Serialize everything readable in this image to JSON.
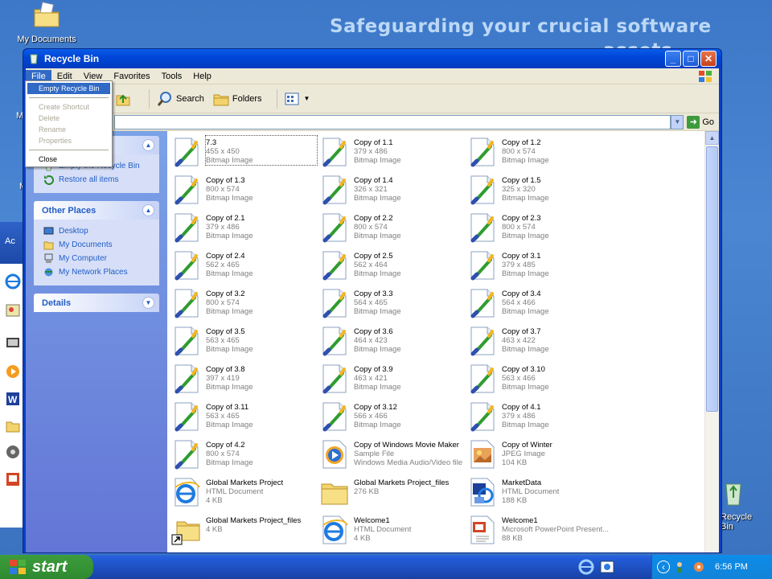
{
  "banner": {
    "line1": "Safeguarding your crucial software",
    "line2": "assets"
  },
  "desktop": {
    "my_documents": "My Documents",
    "recycle_bin": "Recycle Bin",
    "partial_labels": [
      "M",
      "M",
      "Ac"
    ]
  },
  "window": {
    "title": "Recycle Bin",
    "buttons": {
      "minimize": "_",
      "maximize": "□",
      "close": "✕"
    }
  },
  "menubar": [
    "File",
    "Edit",
    "View",
    "Favorites",
    "Tools",
    "Help"
  ],
  "file_menu": {
    "items": [
      {
        "label": "Empty Recycle Bin",
        "state": "highlighted"
      },
      {
        "label": "Create Shortcut",
        "state": "disabled"
      },
      {
        "label": "Delete",
        "state": "disabled"
      },
      {
        "label": "Rename",
        "state": "disabled"
      },
      {
        "label": "Properties",
        "state": "disabled"
      },
      {
        "label": "Close",
        "state": "normal"
      }
    ]
  },
  "toolbar": {
    "search": "Search",
    "folders": "Folders"
  },
  "address": {
    "go": "Go"
  },
  "tasks_panel": {
    "partial_items": [
      "Empty the Recycle Bin",
      "Restore all items"
    ]
  },
  "other_places": {
    "title": "Other Places",
    "items": [
      "Desktop",
      "My Documents",
      "My Computer",
      "My Network Places"
    ]
  },
  "details": {
    "title": "Details"
  },
  "files": [
    {
      "name": "7.3",
      "l2": "455 x 450",
      "l3": "Bitmap Image",
      "icon": "bitmap",
      "selected": true
    },
    {
      "name": "Copy of 1.1",
      "l2": "379 x 486",
      "l3": "Bitmap Image",
      "icon": "bitmap"
    },
    {
      "name": "Copy of 1.2",
      "l2": "800 x 574",
      "l3": "Bitmap Image",
      "icon": "bitmap"
    },
    {
      "name": "Copy of 1.3",
      "l2": "800 x 574",
      "l3": "Bitmap Image",
      "icon": "bitmap"
    },
    {
      "name": "Copy of 1.4",
      "l2": "326 x 321",
      "l3": "Bitmap Image",
      "icon": "bitmap"
    },
    {
      "name": "Copy of 1.5",
      "l2": "325 x 320",
      "l3": "Bitmap Image",
      "icon": "bitmap"
    },
    {
      "name": "Copy of 2.1",
      "l2": "379 x 486",
      "l3": "Bitmap Image",
      "icon": "bitmap"
    },
    {
      "name": "Copy of 2.2",
      "l2": "800 x 574",
      "l3": "Bitmap Image",
      "icon": "bitmap"
    },
    {
      "name": "Copy of 2.3",
      "l2": "800 x 574",
      "l3": "Bitmap Image",
      "icon": "bitmap"
    },
    {
      "name": "Copy of 2.4",
      "l2": "562 x 465",
      "l3": "Bitmap Image",
      "icon": "bitmap"
    },
    {
      "name": "Copy of 2.5",
      "l2": "562 x 464",
      "l3": "Bitmap Image",
      "icon": "bitmap"
    },
    {
      "name": "Copy of 3.1",
      "l2": "379 x 485",
      "l3": "Bitmap Image",
      "icon": "bitmap"
    },
    {
      "name": "Copy of 3.2",
      "l2": "800 x 574",
      "l3": "Bitmap Image",
      "icon": "bitmap"
    },
    {
      "name": "Copy of 3.3",
      "l2": "564 x 465",
      "l3": "Bitmap Image",
      "icon": "bitmap"
    },
    {
      "name": "Copy of 3.4",
      "l2": "564 x 466",
      "l3": "Bitmap Image",
      "icon": "bitmap"
    },
    {
      "name": "Copy of 3.5",
      "l2": "563 x 465",
      "l3": "Bitmap Image",
      "icon": "bitmap"
    },
    {
      "name": "Copy of 3.6",
      "l2": "464 x 423",
      "l3": "Bitmap Image",
      "icon": "bitmap"
    },
    {
      "name": "Copy of 3.7",
      "l2": "463 x 422",
      "l3": "Bitmap Image",
      "icon": "bitmap"
    },
    {
      "name": "Copy of 3.8",
      "l2": "397 x 419",
      "l3": "Bitmap Image",
      "icon": "bitmap"
    },
    {
      "name": "Copy of 3.9",
      "l2": "463 x 421",
      "l3": "Bitmap Image",
      "icon": "bitmap"
    },
    {
      "name": "Copy of 3.10",
      "l2": "563 x 466",
      "l3": "Bitmap Image",
      "icon": "bitmap"
    },
    {
      "name": "Copy of 3.11",
      "l2": "563 x 465",
      "l3": "Bitmap Image",
      "icon": "bitmap"
    },
    {
      "name": "Copy of 3.12",
      "l2": "566 x 466",
      "l3": "Bitmap Image",
      "icon": "bitmap"
    },
    {
      "name": "Copy of 4.1",
      "l2": "379 x 486",
      "l3": "Bitmap Image",
      "icon": "bitmap"
    },
    {
      "name": "Copy of 4.2",
      "l2": "800 x 574",
      "l3": "Bitmap Image",
      "icon": "bitmap"
    },
    {
      "name": "Copy of Windows Movie Maker",
      "l2": "Sample File",
      "l3": "Windows Media Audio/Video file",
      "icon": "wmv"
    },
    {
      "name": "Copy of Winter",
      "l2": "JPEG Image",
      "l3": "104 KB",
      "icon": "jpeg"
    },
    {
      "name": "Global Markets Project",
      "l2": "HTML Document",
      "l3": "4 KB",
      "icon": "ie"
    },
    {
      "name": "Global Markets Project_files",
      "l2": "276 KB",
      "l3": "",
      "icon": "folder"
    },
    {
      "name": "MarketData",
      "l2": "HTML Document",
      "l3": "188 KB",
      "icon": "xmlhtml"
    },
    {
      "name": "Global Markets Project_files",
      "l2": "4 KB",
      "l3": "",
      "icon": "shortcutfolder"
    },
    {
      "name": "Welcome1",
      "l2": "HTML Document",
      "l3": "4 KB",
      "icon": "ie"
    },
    {
      "name": "Welcome1",
      "l2": "Microsoft PowerPoint Present...",
      "l3": "88 KB",
      "icon": "ppt"
    }
  ],
  "taskbar": {
    "start": "start",
    "clock": "6:56 PM"
  }
}
